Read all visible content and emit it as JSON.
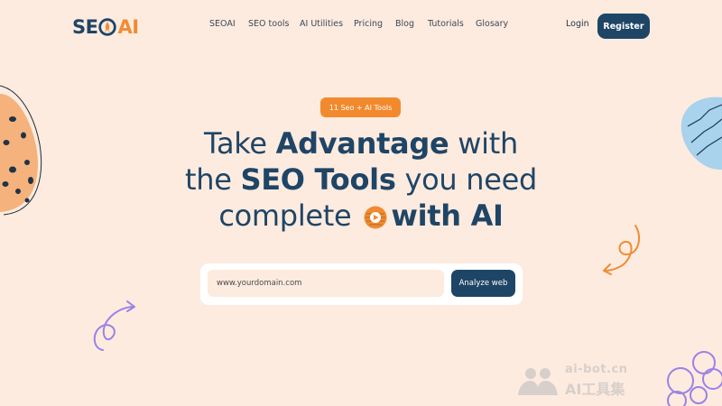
{
  "header": {
    "logo_prefix": "SE",
    "logo_suffix": "AI",
    "nav": [
      {
        "label": "SEOAI"
      },
      {
        "label": "SEO tools"
      },
      {
        "label": "AI Utilities"
      },
      {
        "label": "Pricing"
      },
      {
        "label": "Blog"
      },
      {
        "label": "Tutorials"
      },
      {
        "label": "Glosary"
      }
    ],
    "login_label": "Login",
    "register_label": "Register"
  },
  "hero": {
    "badge": "11 Seo + AI Tools",
    "headline_1a": "Take ",
    "headline_1b": "Advantage",
    "headline_1c": " with",
    "headline_2a": "the ",
    "headline_2b": "SEO Tools",
    "headline_2c": " you need",
    "headline_3a": "complete ",
    "headline_3b": "with AI"
  },
  "search": {
    "placeholder": "www.yourdomain.com",
    "button_label": "Analyze web"
  },
  "watermark": {
    "top": "ai-bot.cn",
    "bottom": "AI工具集"
  },
  "colors": {
    "background": "#fdebdf",
    "primary": "#1f4566",
    "accent": "#f28a2d"
  }
}
